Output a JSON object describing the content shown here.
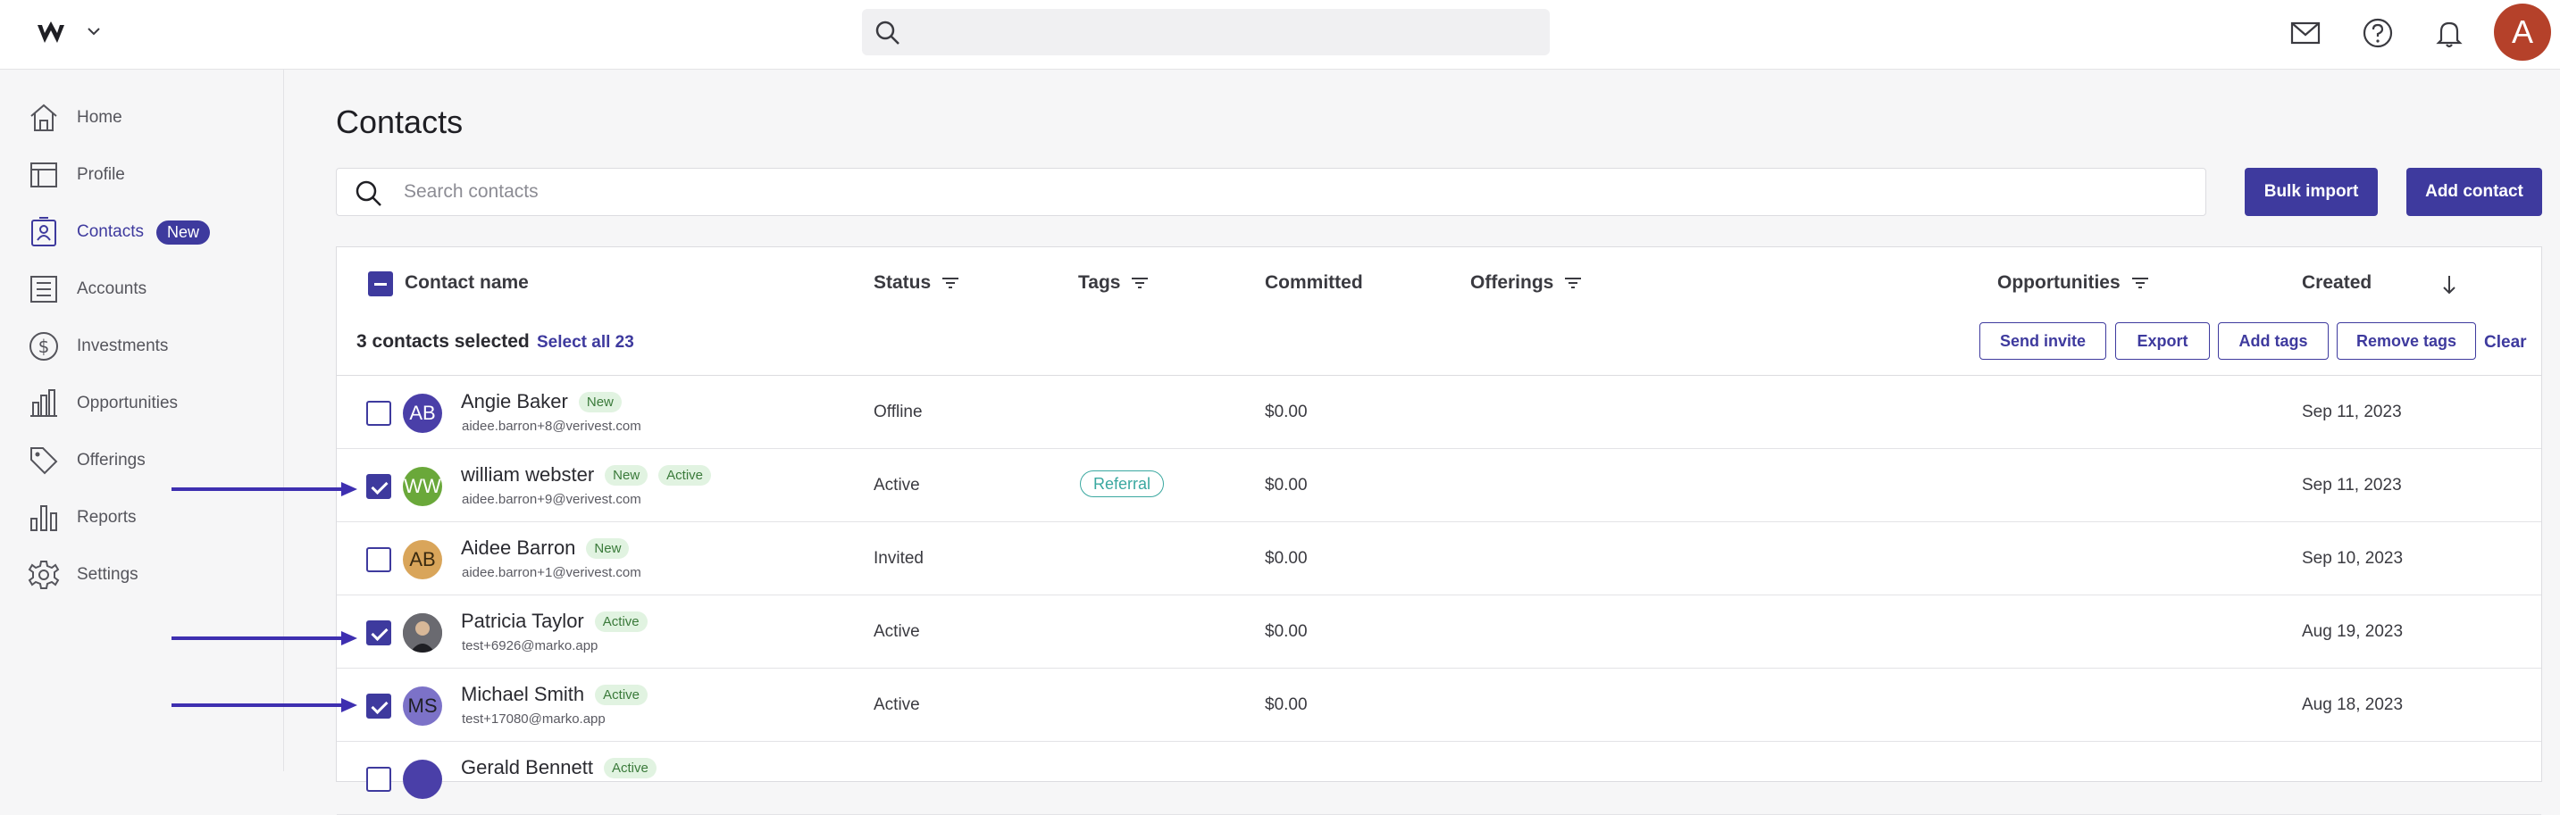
{
  "header": {
    "search_placeholder": "",
    "avatar_letter": "A",
    "icons": [
      "mail-icon",
      "help-icon",
      "bell-icon"
    ]
  },
  "sidebar": {
    "items": [
      {
        "label": "Home",
        "icon": "home-icon"
      },
      {
        "label": "Profile",
        "icon": "profile-icon"
      },
      {
        "label": "Contacts",
        "icon": "contacts-icon",
        "badge": "New",
        "active": true
      },
      {
        "label": "Accounts",
        "icon": "accounts-icon"
      },
      {
        "label": "Investments",
        "icon": "investments-icon"
      },
      {
        "label": "Opportunities",
        "icon": "opportunities-icon"
      },
      {
        "label": "Offerings",
        "icon": "offerings-icon"
      },
      {
        "label": "Reports",
        "icon": "reports-icon"
      },
      {
        "label": "Settings",
        "icon": "settings-icon"
      }
    ]
  },
  "main": {
    "title": "Contacts",
    "search_placeholder": "Search contacts",
    "bulk_import_label": "Bulk import",
    "add_contact_label": "Add contact"
  },
  "table": {
    "columns": {
      "contact_name": "Contact name",
      "status": "Status",
      "tags": "Tags",
      "committed": "Committed",
      "offerings": "Offerings",
      "opportunities": "Opportunities",
      "created": "Created"
    },
    "selection": {
      "text": "3 contacts selected",
      "select_all": "Select all 23",
      "send_invite": "Send invite",
      "export": "Export",
      "add_tags": "Add tags",
      "remove_tags": "Remove tags",
      "clear": "Clear"
    },
    "rows": [
      {
        "initials": "AB",
        "name": "Angie Baker",
        "pills": [
          "New"
        ],
        "email": "aidee.barron+8@verivest.com",
        "status": "Offline",
        "tag": "",
        "committed": "$0.00",
        "created": "Sep 11, 2023",
        "checked": false,
        "avatar_color": "#4a3fa8"
      },
      {
        "initials": "WW",
        "name": "william webster",
        "pills": [
          "New",
          "Active"
        ],
        "email": "aidee.barron+9@verivest.com",
        "status": "Active",
        "tag": "Referral",
        "committed": "$0.00",
        "created": "Sep 11, 2023",
        "checked": true,
        "avatar_color": "#6aa83a"
      },
      {
        "initials": "AB",
        "name": "Aidee Barron",
        "pills": [
          "New"
        ],
        "email": "aidee.barron+1@verivest.com",
        "status": "Invited",
        "tag": "",
        "committed": "$0.00",
        "created": "Sep 10, 2023",
        "checked": false,
        "avatar_color": "#d9a55a"
      },
      {
        "initials": "",
        "name": "Patricia Taylor",
        "pills": [
          "Active"
        ],
        "email": "test+6926@marko.app",
        "status": "Active",
        "tag": "",
        "committed": "$0.00",
        "created": "Aug 19, 2023",
        "checked": true,
        "avatar_color": "#3a3a40"
      },
      {
        "initials": "MS",
        "name": "Michael Smith",
        "pills": [
          "Active"
        ],
        "email": "test+17080@marko.app",
        "status": "Active",
        "tag": "",
        "committed": "$0.00",
        "created": "Aug 18, 2023",
        "checked": true,
        "avatar_color": "#7c72c8"
      },
      {
        "initials": "",
        "name": "Gerald Bennett",
        "pills": [
          "Active"
        ],
        "email": "",
        "status": "",
        "tag": "",
        "committed": "",
        "created": "",
        "checked": false,
        "avatar_color": "#4a3fa8"
      }
    ]
  },
  "colors": {
    "accent": "#3e3a9e",
    "avatar_top": "#b5412a",
    "active_pill_bg": "#e1f3e1",
    "referral": "#3aa8a0"
  }
}
